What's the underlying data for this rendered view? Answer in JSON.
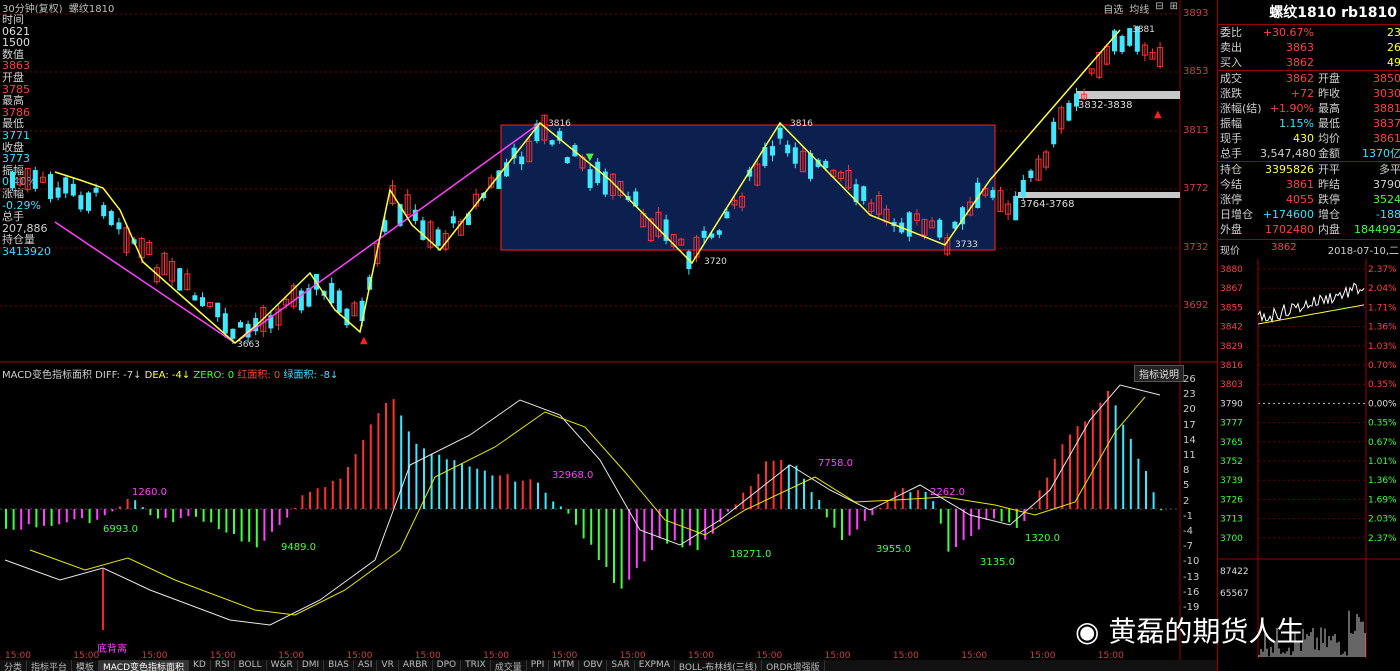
{
  "header": {
    "period": "30分钟(复权)",
    "symbol": "螺纹1810",
    "buttons": [
      "自选",
      "均线",
      "⊟",
      "⊞"
    ]
  },
  "info_panel": [
    {
      "label": "时间",
      "value": "0621"
    },
    {
      "label": "",
      "value": "1500"
    },
    {
      "label": "数值",
      "value": "3863",
      "color": "red"
    },
    {
      "label": "开盘",
      "value": "3785",
      "color": "red"
    },
    {
      "label": "最高",
      "value": "3786",
      "color": "red"
    },
    {
      "label": "最低",
      "value": "3771",
      "color": "cyan"
    },
    {
      "label": "收盘",
      "value": "3773",
      "color": "cyan"
    },
    {
      "label": "振幅",
      "value": "0.40%",
      "color": "cyan"
    },
    {
      "label": "涨幅",
      "value": "-0.29%",
      "color": "cyan"
    },
    {
      "label": "总手",
      "value": "207,886",
      "color": "wl"
    },
    {
      "label": "持仓量",
      "value": "3413920",
      "color": "cyan"
    }
  ],
  "price_axis": [
    "3893",
    "3853",
    "3813",
    "3772",
    "3732",
    "3692"
  ],
  "annotations": {
    "low_3663": "3663",
    "high_3816a": "3816",
    "low_3720": "3720",
    "high_3816b": "3816",
    "low_3733": "3733",
    "high_3881": "3881",
    "band_upper": "3832-3838",
    "band_lower": "3764-3768"
  },
  "macd": {
    "title": "MACD变色指标面积",
    "diff": "DIFF: -7↓",
    "dea": "DEA: -4↓",
    "zero": "ZERO: 0",
    "red_area": "红面积: 0",
    "green_area": "绿面积: -8↓",
    "explain_button": "指标说明",
    "axis": [
      "26",
      "23",
      "20",
      "17",
      "14",
      "11",
      "8",
      "5",
      "2",
      "-1",
      "-4",
      "-7",
      "-10",
      "-13",
      "-16",
      "-19"
    ],
    "labels": [
      "1260.0",
      "6993.0",
      "9489.0",
      "32968.0",
      "18271.0",
      "7758.0",
      "3955.0",
      "2262.0",
      "3135.0",
      "1320.0",
      "底背离"
    ]
  },
  "time_axis": [
    "15:00",
    "15:00",
    "15:00",
    "15:00",
    "15:00",
    "15:00",
    "15:00",
    "15:00",
    "15:00",
    "15:00",
    "15:00",
    "15:00",
    "15:00",
    "15:00",
    "15:00",
    "15:00",
    "15:00"
  ],
  "quote": {
    "title": "螺纹1810 rb1810",
    "rows": [
      {
        "k": "委比",
        "v": "+30.67%",
        "c": "red",
        "k2": "",
        "v2": "23"
      },
      {
        "k": "卖出",
        "v": "3863",
        "c": "red",
        "k2": "",
        "v2": "26"
      },
      {
        "k": "买入",
        "v": "3862",
        "c": "red",
        "k2": "",
        "v2": "49"
      }
    ],
    "rows2": [
      {
        "k": "成交",
        "v": "3862",
        "c": "red",
        "k2": "开盘",
        "v2": "3850",
        "c2": "red"
      },
      {
        "k": "涨跌",
        "v": "+72",
        "c": "red",
        "k2": "昨收",
        "v2": "3030",
        "c2": "red"
      },
      {
        "k": "涨幅(结)",
        "v": "+1.90%",
        "c": "red",
        "k2": "最高",
        "v2": "3881",
        "c2": "red"
      },
      {
        "k": "振幅",
        "v": "1.15%",
        "c": "cyan",
        "k2": "最低",
        "v2": "3837",
        "c2": "red"
      },
      {
        "k": "现手",
        "v": "430",
        "c": "yel",
        "k2": "均价",
        "v2": "3861",
        "c2": "red"
      },
      {
        "k": "总手",
        "v": "3,547,480",
        "c": "wl",
        "k2": "金额",
        "v2": "1370亿",
        "c2": "cyan"
      }
    ],
    "rows3": [
      {
        "k": "持仓",
        "v": "3395826",
        "c": "yel",
        "k2": "开平",
        "v2": "多平",
        "c2": "wl"
      },
      {
        "k": "今结",
        "v": "3861",
        "c": "red",
        "k2": "昨结",
        "v2": "3790",
        "c2": "wl"
      },
      {
        "k": "涨停",
        "v": "4055",
        "c": "red",
        "k2": "跌停",
        "v2": "3524",
        "c2": "grn"
      },
      {
        "k": "日增仓",
        "v": "+174600",
        "c": "cyan",
        "k2": "增仓",
        "v2": "-188",
        "c2": "cyan"
      },
      {
        "k": "外盘",
        "v": "1702480",
        "c": "red",
        "k2": "内盘",
        "v2": "1844992",
        "c2": "grn"
      }
    ],
    "mini_header": {
      "label": "现价",
      "value": "3862",
      "date": "2018-07-10,二"
    },
    "mini_left": [
      "3880",
      "3867",
      "3855",
      "3842",
      "3829",
      "3816",
      "3803",
      "3790",
      "3777",
      "3765",
      "3752",
      "3739",
      "3726",
      "3713",
      "3700"
    ],
    "mini_right": [
      "2.37%",
      "2.04%",
      "1.71%",
      "1.36%",
      "1.03%",
      "0.70%",
      "0.35%",
      "0.00%",
      "0.35%",
      "0.67%",
      "1.01%",
      "1.36%",
      "1.69%",
      "2.03%",
      "2.37%"
    ],
    "vol_labels": [
      "87422",
      "65567"
    ]
  },
  "bottom_tabs": [
    "分类",
    "指标平台",
    "模板",
    "MACD变色指标面积",
    "KD",
    "RSI",
    "BOLL",
    "W&R",
    "DMI",
    "BIAS",
    "ASI",
    "VR",
    "ARBR",
    "DPO",
    "TRIX",
    "成交量",
    "PPI",
    "MTM",
    "OBV",
    "SAR",
    "EXPMA",
    "BOLL-布林线(三线)",
    "ORDR增强版"
  ],
  "watermark": "黄磊的期货人生",
  "colors": {
    "up": "#ff3030",
    "down": "#40e8ff",
    "magenta": "#ff40ff",
    "yellow": "#ffff40",
    "box": "#0c2050"
  }
}
